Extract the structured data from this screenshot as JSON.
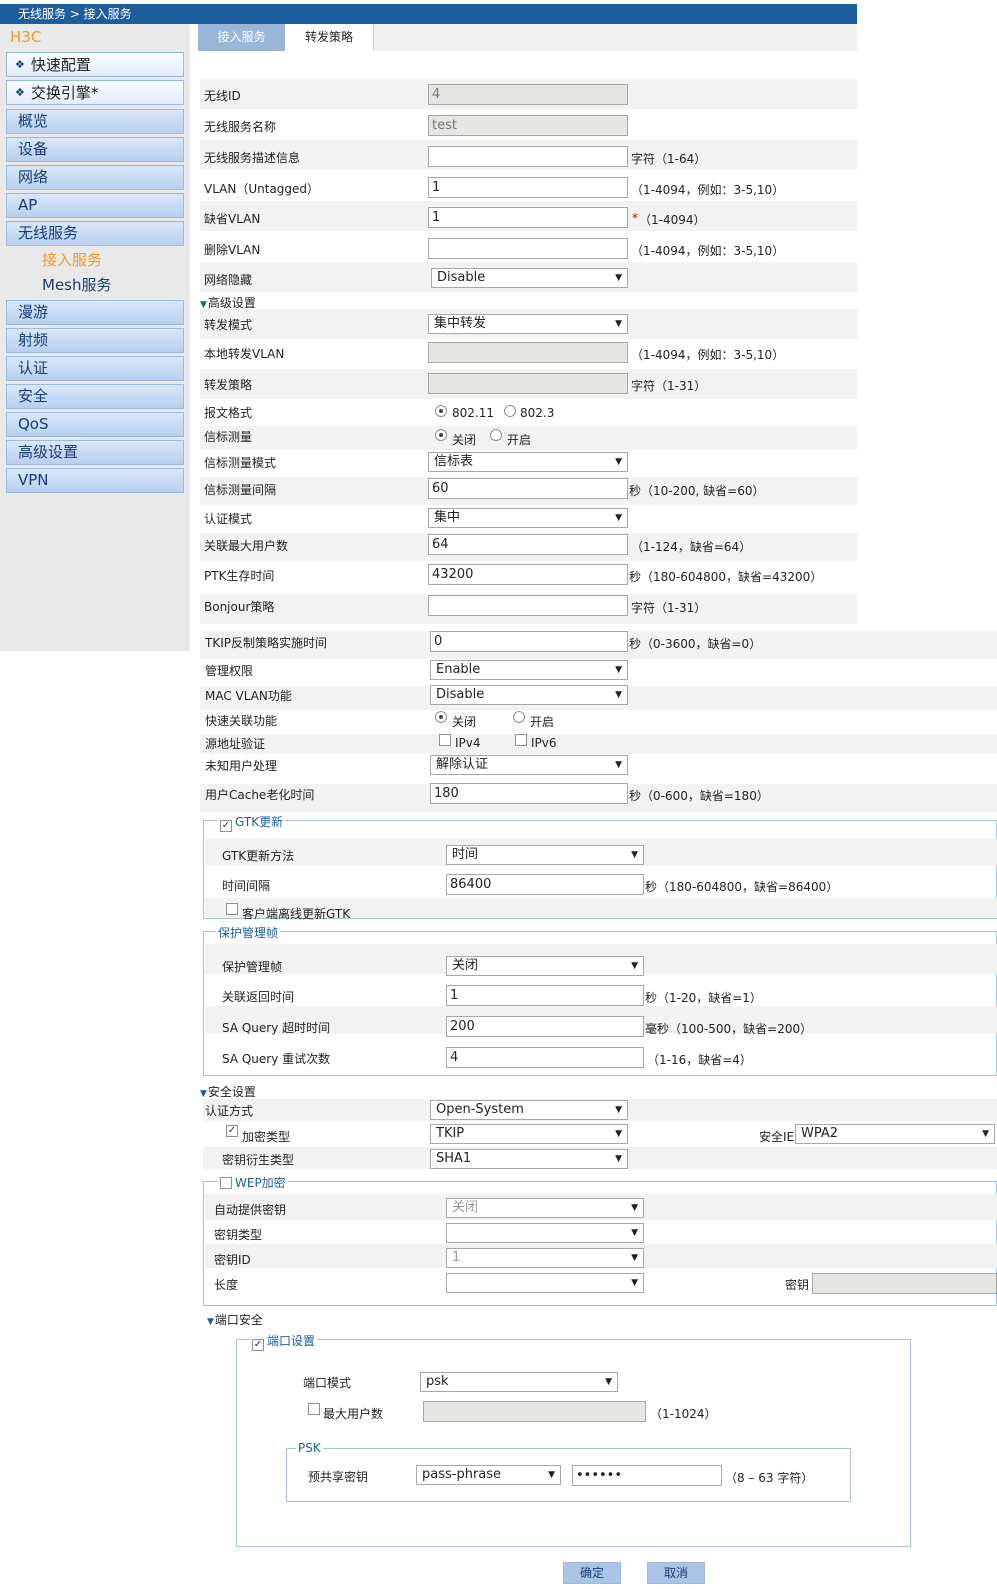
{
  "breadcrumb": "无线服务 > 接入服务",
  "sidebar": {
    "brand": "H3C",
    "quick_items": [
      "快速配置",
      "交换引擎*"
    ],
    "items": [
      "概览",
      "设备",
      "网络",
      "AP",
      "无线服务"
    ],
    "sub_items": [
      "接入服务",
      "Mesh服务"
    ],
    "items_after": [
      "漫游",
      "射频",
      "认证",
      "安全",
      "QoS",
      "高级设置",
      "VPN"
    ],
    "colors": {
      "brand": "#f39c27",
      "active_sub": "#f39c27"
    }
  },
  "tabs": [
    "接入服务",
    "转发策略"
  ],
  "form": {
    "wireless_id": {
      "label": "无线ID",
      "value": "4"
    },
    "service_name": {
      "label": "无线服务名称",
      "value": "test"
    },
    "description": {
      "label": "无线服务描述信息",
      "value": "",
      "hint": "字符（1-64）"
    },
    "vlan_untagged": {
      "label": "VLAN（Untagged）",
      "value": "1",
      "hint": "（1-4094，例如：3-5,10）"
    },
    "default_vlan": {
      "label": "缺省VLAN",
      "value": "1",
      "required": "*",
      "hint": "（1-4094）"
    },
    "delete_vlan": {
      "label": "删除VLAN",
      "value": "",
      "hint": "（1-4094，例如：3-5,10）"
    },
    "hide_network": {
      "label": "网络隐藏",
      "value": "Disable"
    }
  },
  "advanced": {
    "title": "高级设置",
    "forward_mode": {
      "label": "转发模式",
      "value": "集中转发"
    },
    "local_vlan": {
      "label": "本地转发VLAN",
      "value": "",
      "hint": "（1-4094，例如：3-5,10）"
    },
    "forward_policy": {
      "label": "转发策略",
      "value": "",
      "hint": "字符（1-31）"
    },
    "frame_format": {
      "label": "报文格式",
      "options": [
        "802.11",
        "802.3"
      ],
      "selected": "802.11"
    },
    "beacon_measure": {
      "label": "信标测量",
      "options": [
        "关闭",
        "开启"
      ],
      "selected": "关闭"
    },
    "beacon_mode": {
      "label": "信标测量模式",
      "value": "信标表"
    },
    "beacon_interval": {
      "label": "信标测量间隔",
      "value": "60",
      "hint": "秒（10-200, 缺省=60）"
    },
    "auth_mode": {
      "label": "认证模式",
      "value": "集中"
    },
    "max_users": {
      "label": "关联最大用户数",
      "value": "64",
      "hint": "（1-124，缺省=64）"
    },
    "ptk_lifetime": {
      "label": "PTK生存时间",
      "value": "43200",
      "hint": "秒（180-604800，缺省=43200）"
    },
    "bonjour": {
      "label": "Bonjour策略",
      "value": "",
      "hint": "字符（1-31）"
    },
    "tkip_time": {
      "label": "TKIP反制策略实施时间",
      "value": "0",
      "hint": "秒（0-3600，缺省=0）"
    },
    "admin_rights": {
      "label": "管理权限",
      "value": "Enable"
    },
    "mac_vlan": {
      "label": "MAC VLAN功能",
      "value": "Disable"
    },
    "fast_assoc": {
      "label": "快速关联功能",
      "options": [
        "关闭",
        "开启"
      ],
      "selected": "关闭"
    },
    "src_verify": {
      "label": "源地址验证",
      "options": [
        "IPv4",
        "IPv6"
      ]
    },
    "unknown_user": {
      "label": "未知用户处理",
      "value": "解除认证"
    },
    "cache_age": {
      "label": "用户Cache老化时间",
      "value": "180",
      "hint": "秒（0-600，缺省=180）"
    }
  },
  "gtk": {
    "legend": "GTK更新",
    "checked": true,
    "method": {
      "label": "GTK更新方法",
      "value": "时间"
    },
    "interval": {
      "label": "时间间隔",
      "value": "86400",
      "hint": "秒（180-604800，缺省=86400）"
    },
    "offline": {
      "label": "客户端离线更新GTK",
      "checked": false
    }
  },
  "pmf": {
    "legend": "保护管理帧",
    "pmf": {
      "label": "保护管理帧",
      "value": "关闭"
    },
    "assoc_return": {
      "label": "关联返回时间",
      "value": "1",
      "hint": "秒（1-20，缺省=1）"
    },
    "sa_timeout": {
      "label": "SA Query 超时时间",
      "value": "200",
      "hint": "毫秒（100-500，缺省=200）"
    },
    "sa_retry": {
      "label": "SA Query 重试次数",
      "value": "4",
      "hint": "（1-16，缺省=4）"
    }
  },
  "security": {
    "title": "安全设置",
    "auth_method": {
      "label": "认证方式",
      "value": "Open-System"
    },
    "cipher": {
      "label": "加密类型",
      "value": "TKIP",
      "checked": true
    },
    "security_ie": {
      "label": "安全IE",
      "value": "WPA2"
    },
    "key_derivation": {
      "label": "密钥衍生类型",
      "value": "SHA1"
    }
  },
  "wep": {
    "legend": "WEP加密",
    "auto_key": {
      "label": "自动提供密钥",
      "value": "关闭"
    },
    "key_type": {
      "label": "密钥类型",
      "value": ""
    },
    "key_id": {
      "label": "密钥ID",
      "value": "1"
    },
    "length": {
      "label": "长度",
      "value": ""
    },
    "key": {
      "label": "密钥",
      "value": ""
    }
  },
  "port_security": {
    "title": "端口安全",
    "legend": "端口设置",
    "port_mode": {
      "label": "端口模式",
      "value": "psk"
    },
    "max_users": {
      "label": "最大用户数",
      "value": "",
      "hint": "（1-1024）"
    },
    "psk": {
      "legend": "PSK",
      "label": "预共享密钥",
      "type": "pass-phrase",
      "value": "••••••",
      "hint": "（8 – 63 字符）"
    }
  },
  "buttons": {
    "ok": "确定",
    "cancel": "取消"
  }
}
